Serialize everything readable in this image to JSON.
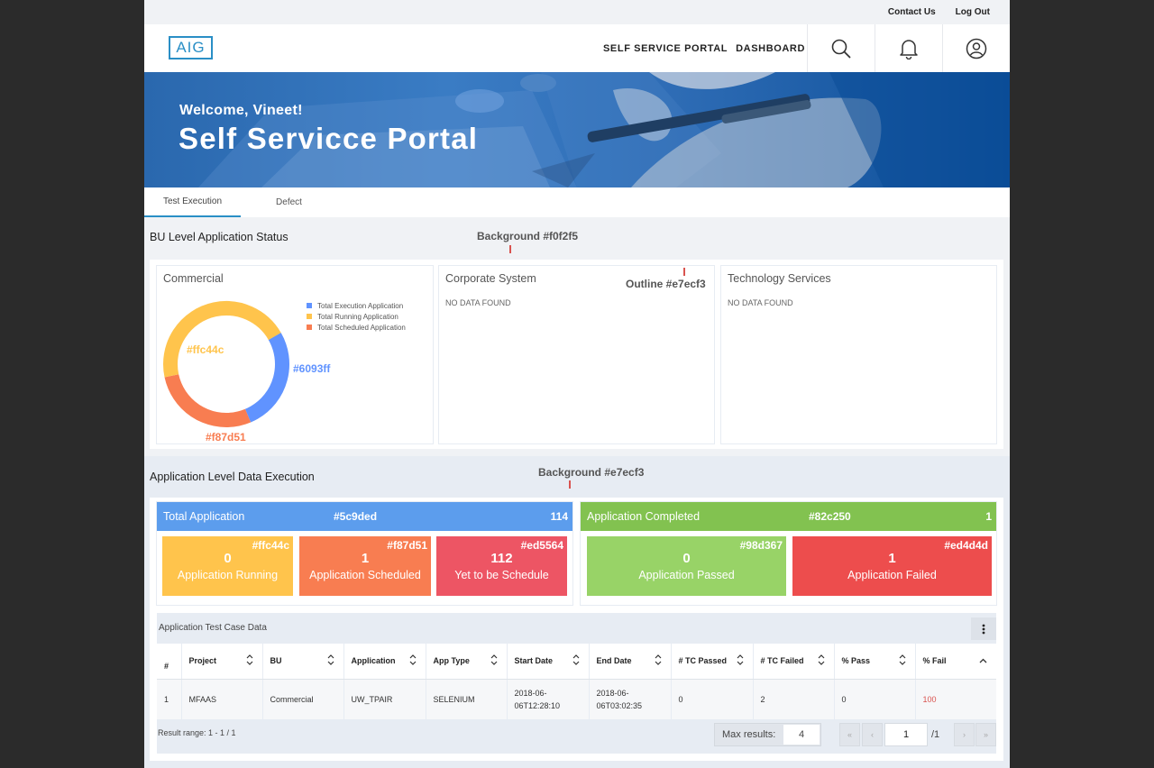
{
  "utility": {
    "contact": "Contact Us",
    "logout": "Log Out"
  },
  "header": {
    "logo": "AIG",
    "nav": [
      "SELF SERVICE PORTAL",
      "DASHBOARD"
    ],
    "icons": [
      "search-icon",
      "bell-icon",
      "user-icon"
    ]
  },
  "banner": {
    "welcome": "Welcome, Vineet!",
    "title": "Self Servicce Portal"
  },
  "tabs": [
    {
      "label": "Test Execution",
      "active": true
    },
    {
      "label": "Defect",
      "active": false
    }
  ],
  "bu_section": {
    "title": "BU Level Application Status",
    "annotation": "Background #f0f2f5",
    "outline_annotation": "Outline #e7ecf3",
    "cards": [
      {
        "title": "Commercial"
      },
      {
        "title": "Corporate System",
        "message": "NO DATA FOUND"
      },
      {
        "title": "Technology Services",
        "message": "NO DATA FOUND"
      }
    ],
    "legend": [
      {
        "label": "Total Execution Application",
        "color": "#6093ff"
      },
      {
        "label": "Total Running Application",
        "color": "#ffc44c"
      },
      {
        "label": "Total Scheduled Application",
        "color": "#f87d51"
      }
    ],
    "donut_labels": {
      "blue": "#6093ff",
      "yellow": "#ffc44c",
      "orange": "#f87d51"
    }
  },
  "chart_data": {
    "type": "pie",
    "title": "Commercial",
    "series": [
      {
        "name": "Total Execution Application",
        "color": "#6093ff",
        "share": 0.27
      },
      {
        "name": "Total Running Application",
        "color": "#ffc44c",
        "share": 0.45
      },
      {
        "name": "Total Scheduled Application",
        "color": "#f87d51",
        "share": 0.28
      }
    ],
    "legend_position": "top-right",
    "donut": true
  },
  "app_section": {
    "title": "Application Level Data Execution",
    "annotation": "Background #e7ecf3",
    "total": {
      "label": "Total Application",
      "hex": "#5c9ded",
      "count": "114",
      "color": "#5c9ded"
    },
    "completed": {
      "label": "Application Completed",
      "hex": "#82c250",
      "count": "1",
      "color": "#82c250"
    },
    "tiles": [
      {
        "hex": "#ffc44c",
        "num": "0",
        "label": "Application Running",
        "color": "#ffc44c"
      },
      {
        "hex": "#f87d51",
        "num": "1",
        "label": "Application Scheduled",
        "color": "#f87d51"
      },
      {
        "hex": "#ed5564",
        "num": "112",
        "label": "Yet to be Schedule",
        "color": "#ed5564"
      },
      {
        "hex": "#98d367",
        "num": "0",
        "label": "Application Passed",
        "color": "#98d367"
      },
      {
        "hex": "#ed4d4d",
        "num": "1",
        "label": "Application Failed",
        "color": "#ed4d4d"
      }
    ]
  },
  "table": {
    "caption": "Application Test Case Data",
    "columns": [
      "#",
      "Project",
      "BU",
      "Application",
      "App Type",
      "Start Date",
      "End Date",
      "# TC Passed",
      "# TC Failed",
      "% Pass",
      "% Fail"
    ],
    "rows": [
      [
        "1",
        "MFAAS",
        "Commercial",
        "UW_TPAIR",
        "SELENIUM",
        "2018-06-06T12:28:10",
        "2018-06-06T03:02:35",
        "0",
        "2",
        "0",
        "100"
      ]
    ],
    "result_range": "Result range: 1 - 1 / 1",
    "max_results_label": "Max results:",
    "max_results_value": "4",
    "page": "1",
    "page_total": "/1"
  }
}
